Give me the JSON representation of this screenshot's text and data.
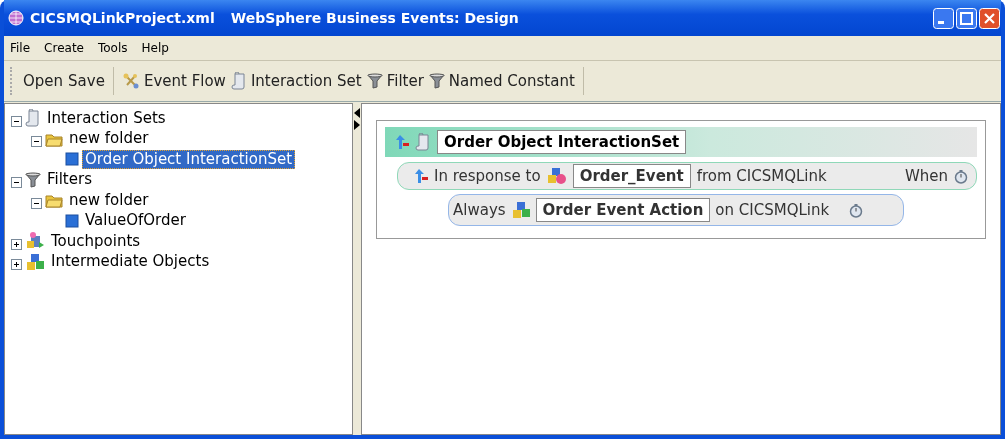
{
  "window": {
    "document": "CICSMQLinkProject.xml",
    "title": "WebSphere Business Events: Design"
  },
  "menu": [
    "File",
    "Create",
    "Tools",
    "Help"
  ],
  "toolbar": [
    {
      "label": "Open"
    },
    {
      "label": "Save"
    },
    {
      "label": "Event Flow",
      "kind": "flow"
    },
    {
      "label": "Interaction Set",
      "kind": "scroll"
    },
    {
      "label": "Filter",
      "kind": "funnel"
    },
    {
      "label": "Named Constant",
      "kind": "funnel"
    }
  ],
  "tree": [
    {
      "label": "Interaction Sets",
      "kind": "scroll",
      "expanded": true,
      "selected": false,
      "children": [
        {
          "label": "new folder",
          "kind": "folder",
          "expanded": true,
          "selected": false,
          "children": [
            {
              "label": "Order Object InteractionSet",
              "kind": "item",
              "selected": true
            }
          ]
        }
      ]
    },
    {
      "label": "Filters",
      "kind": "funnel",
      "expanded": true,
      "selected": false,
      "children": [
        {
          "label": "new folder",
          "kind": "folder",
          "expanded": true,
          "selected": false,
          "children": [
            {
              "label": "ValueOfOrder",
              "kind": "item",
              "selected": false
            }
          ]
        }
      ]
    },
    {
      "label": "Touchpoints",
      "kind": "touchpoint",
      "expanded": false,
      "selected": false
    },
    {
      "label": "Intermediate Objects",
      "kind": "objects",
      "expanded": false,
      "selected": false
    }
  ],
  "editor": {
    "title": "Order Object InteractionSet",
    "trigger": {
      "prefix": "In response to",
      "event": "Order_Event",
      "suffix": "from CICSMQLink",
      "when": "When"
    },
    "action": {
      "prefix": "Always",
      "name": "Order Event Action",
      "suffix": "on CICSMQLink"
    }
  }
}
